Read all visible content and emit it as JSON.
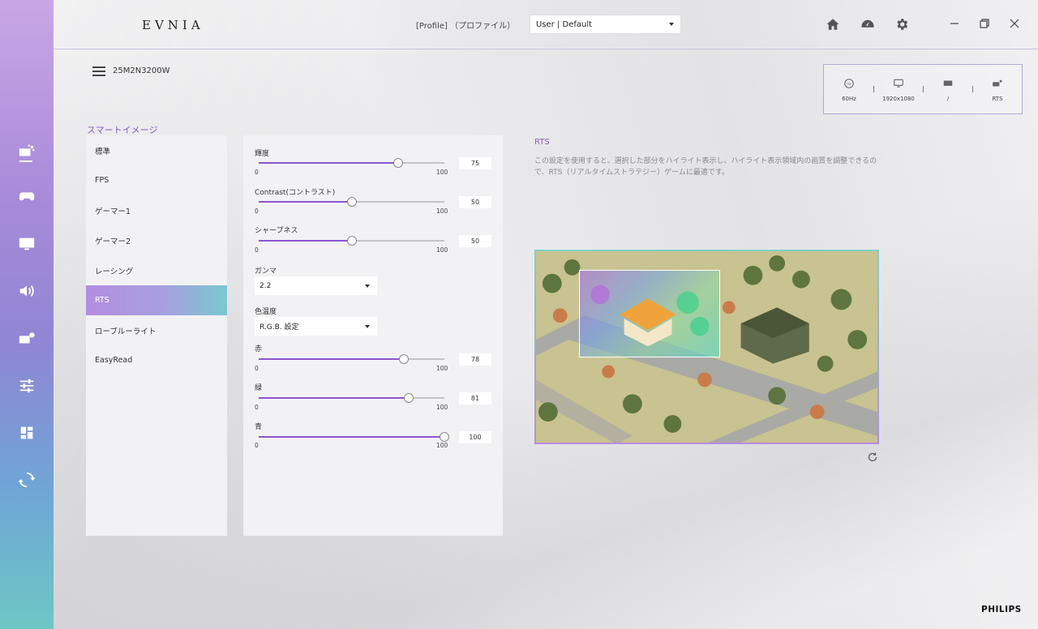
{
  "app": {
    "logo": "EVNIA",
    "profile_label": "[Profile] （プロファイル）",
    "profile_value": "User | Default",
    "model": "25M2N3200W",
    "brand": "PHILIPS"
  },
  "status": {
    "refresh_rate": "60Hz",
    "resolution": "1920x1080",
    "input": "/",
    "mode": "RTS"
  },
  "smart_image": {
    "title": "スマートイメージ",
    "items": [
      {
        "label": "標準"
      },
      {
        "label": "FPS"
      },
      {
        "label": "ゲーマー1"
      },
      {
        "label": "ゲーマー2"
      },
      {
        "label": "レーシング"
      },
      {
        "label": "RTS",
        "active": true
      },
      {
        "label": "ローブルーライト"
      },
      {
        "label": "EasyRead"
      }
    ]
  },
  "settings": {
    "brightness": {
      "label": "輝度",
      "value": 75,
      "min": "0",
      "max": "100"
    },
    "contrast": {
      "label": "Contrast(コントラスト)",
      "value": 50,
      "min": "0",
      "max": "100"
    },
    "sharpness": {
      "label": "シャープネス",
      "value": 50,
      "min": "0",
      "max": "100"
    },
    "gamma": {
      "label": "ガンマ",
      "value": "2.2"
    },
    "color_temp": {
      "label": "色温度",
      "value": "R.G.B. 設定"
    },
    "red": {
      "label": "赤",
      "value": 78,
      "min": "0",
      "max": "100"
    },
    "green": {
      "label": "緑",
      "value": 81,
      "min": "0",
      "max": "100"
    },
    "blue": {
      "label": "青",
      "value": 100,
      "min": "0",
      "max": "100"
    }
  },
  "detail": {
    "title": "RTS",
    "description": "この設定を使用すると、選択した部分をハイライト表示し、ハイライト表示領域内の画質を調整できるので、RTS（リアルタイムストラテジー）ゲームに最適です。"
  },
  "colors": {
    "accent": "#8c55cf",
    "sidebar_top": "#c9a7e6",
    "sidebar_bottom": "#6ec7c4"
  }
}
